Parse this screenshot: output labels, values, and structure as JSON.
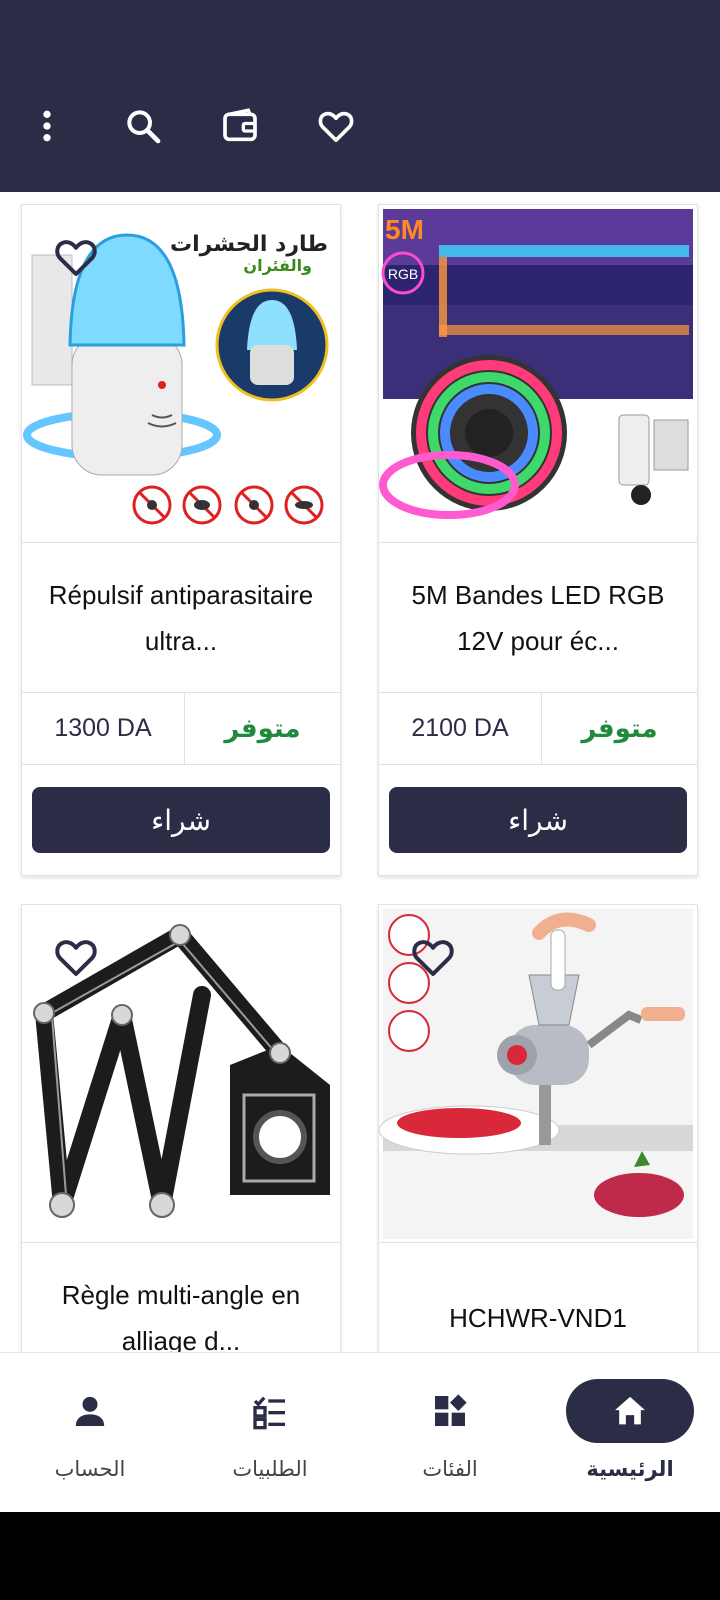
{
  "header": {
    "icons": [
      "more-vert-icon",
      "search-icon",
      "wallet-icon",
      "heart-icon"
    ]
  },
  "products": [
    {
      "title": "5M Bandes LED RGB 12V pour éc...",
      "price": "2100 DA",
      "stock": "متوفر",
      "buy_label": "شراء",
      "image": "led-strip-image",
      "image_text": [
        "5M",
        "RGB"
      ]
    },
    {
      "title": "Répulsif antiparasitaire ultra...",
      "price": "1300 DA",
      "stock": "متوفر",
      "buy_label": "شراء",
      "image": "pest-repeller-image",
      "image_text": [
        "طارد الحشرات",
        "والفئران"
      ]
    },
    {
      "title": "HCHWR-VND1",
      "image": "meat-grinder-image"
    },
    {
      "title": "Règle multi-angle en alliage d...",
      "image": "multi-angle-ruler-image"
    }
  ],
  "bottom_nav": {
    "items": [
      {
        "label": "الرئيسية",
        "icon": "home-icon",
        "active": true
      },
      {
        "label": "الفئات",
        "icon": "categories-icon",
        "active": false
      },
      {
        "label": "الطلبيات",
        "icon": "orders-icon",
        "active": false
      },
      {
        "label": "الحساب",
        "icon": "account-icon",
        "active": false
      }
    ]
  },
  "colors": {
    "primary": "#2b2d47",
    "stock_green": "#1e8a3c",
    "background": "#ffffff"
  }
}
